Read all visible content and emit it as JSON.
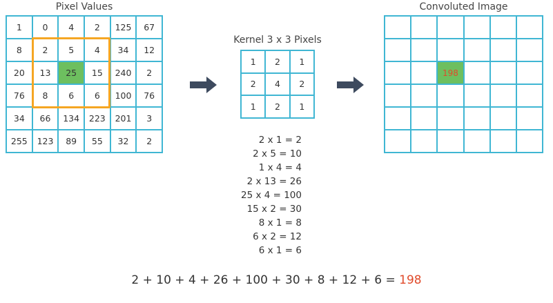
{
  "pixel_values": {
    "title": "Pixel Values",
    "rows": [
      [
        "1",
        "0",
        "4",
        "2",
        "125",
        "67"
      ],
      [
        "8",
        "2",
        "5",
        "4",
        "34",
        "12"
      ],
      [
        "20",
        "13",
        "25",
        "15",
        "240",
        "2"
      ],
      [
        "76",
        "8",
        "6",
        "6",
        "100",
        "76"
      ],
      [
        "34",
        "66",
        "134",
        "223",
        "201",
        "3"
      ],
      [
        "255",
        "123",
        "89",
        "55",
        "32",
        "2"
      ]
    ],
    "highlight_cell": [
      2,
      2
    ],
    "window_rows": [
      1,
      3
    ],
    "window_cols": [
      1,
      3
    ]
  },
  "kernel": {
    "title": "Kernel 3 x 3 Pixels",
    "rows": [
      [
        "1",
        "2",
        "1"
      ],
      [
        "2",
        "4",
        "2"
      ],
      [
        "1",
        "2",
        "1"
      ]
    ]
  },
  "convoluted": {
    "title": "Convoluted Image",
    "result_value": "198",
    "result_cell": [
      2,
      2
    ],
    "size": [
      6,
      6
    ]
  },
  "steps": [
    "2 x 1 = 2",
    "2 x 5 = 10",
    "1 x 4 = 4",
    "2 x 13 = 26",
    "25 x 4 = 100",
    "15 x 2 = 30",
    "8 x 1 = 8",
    "6 x 2 = 12",
    "6 x 1 = 6"
  ],
  "sum": {
    "expression": "2 + 10 + 4 + 26 + 100 + 30 + 8 + 12 + 6 = ",
    "result": "198"
  },
  "colors": {
    "grid_border": "#3fb6d3",
    "window": "#f5a623",
    "highlight": "#6dbf5f",
    "result_text": "#e04a2a",
    "arrow": "#3d4a5e"
  },
  "icons": [
    "arrow-right-icon",
    "arrow-right-icon"
  ]
}
